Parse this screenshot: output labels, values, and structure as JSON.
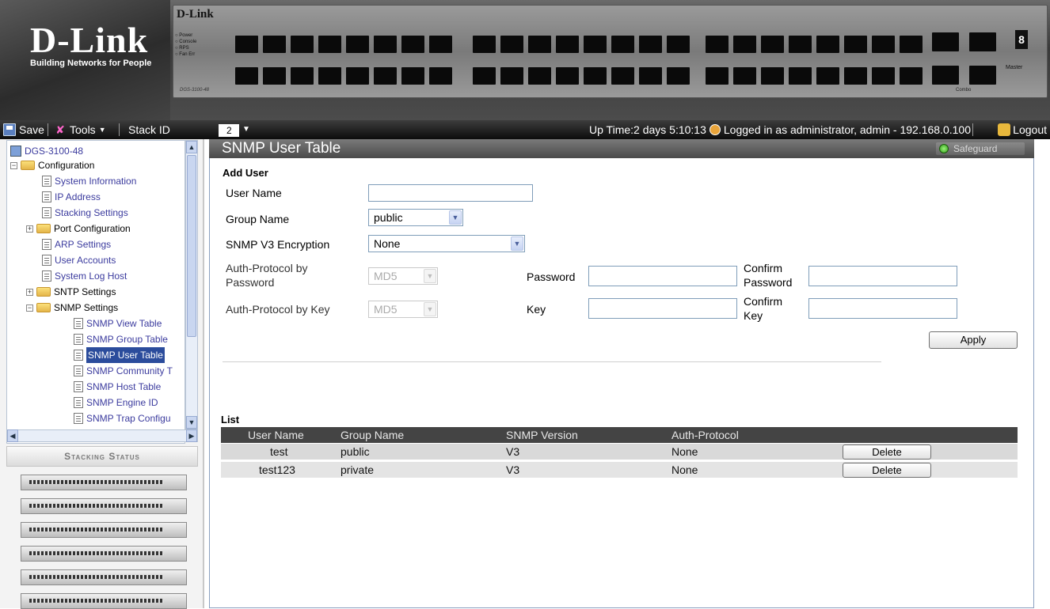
{
  "banner": {
    "logo": "D-Link",
    "tagline": "Building Networks for People",
    "panel_brand": "D-Link",
    "panel_leds": [
      "Power",
      "Console",
      "RPS",
      "Fan Err"
    ],
    "panel_model": "DGS-3100-48",
    "combo_label": "Combo",
    "seven_segment": "8",
    "master_label": "Master"
  },
  "toolbar": {
    "save": "Save",
    "tools": "Tools",
    "stack_id_label": "Stack ID",
    "stack_id_value": "2",
    "status": "Up Time:2 days 5:10:13",
    "logged_in": "Logged in as administrator, admin - 192.168.0.100",
    "logout": "Logout"
  },
  "tree": {
    "root": "DGS-3100-48",
    "configuration": "Configuration",
    "system_information": "System Information",
    "ip_address": "IP Address",
    "stacking_settings": "Stacking Settings",
    "port_configuration": "Port Configuration",
    "arp_settings": "ARP Settings",
    "user_accounts": "User Accounts",
    "system_log_host": "System Log Host",
    "sntp_settings": "SNTP Settings",
    "snmp_settings": "SNMP Settings",
    "snmp_view_table": "SNMP View Table",
    "snmp_group_table": "SNMP Group Table",
    "snmp_user_table": "SNMP User Table",
    "snmp_community": "SNMP Community T",
    "snmp_host_table": "SNMP Host Table",
    "snmp_engine_id": "SNMP Engine ID",
    "snmp_trap": "SNMP Trap Configu"
  },
  "stacking_status": "Stacking Status",
  "page": {
    "title": "SNMP User Table",
    "safeguard": "Safeguard"
  },
  "form": {
    "section": "Add User",
    "user_name_label": "User Name",
    "user_name_value": "",
    "group_name_label": "Group Name",
    "group_name_value": "public",
    "encryption_label": "SNMP V3 Encryption",
    "encryption_value": "None",
    "auth_pw_label_1": "Auth-Protocol by",
    "auth_pw_label_2": "Password",
    "auth_pw_value": "MD5",
    "password_label": "Password",
    "confirm_password_1": "Confirm",
    "confirm_password_2": "Password",
    "auth_key_label": "Auth-Protocol by Key",
    "auth_key_value": "MD5",
    "key_label": "Key",
    "confirm_key_1": "Confirm",
    "confirm_key_2": "Key",
    "apply": "Apply"
  },
  "list": {
    "title": "List",
    "headers": [
      "User Name",
      "Group Name",
      "SNMP Version",
      "Auth-Protocol"
    ],
    "rows": [
      {
        "user": "test",
        "group": "public",
        "version": "V3",
        "auth": "None",
        "action": "Delete"
      },
      {
        "user": "test123",
        "group": "private",
        "version": "V3",
        "auth": "None",
        "action": "Delete"
      }
    ]
  }
}
